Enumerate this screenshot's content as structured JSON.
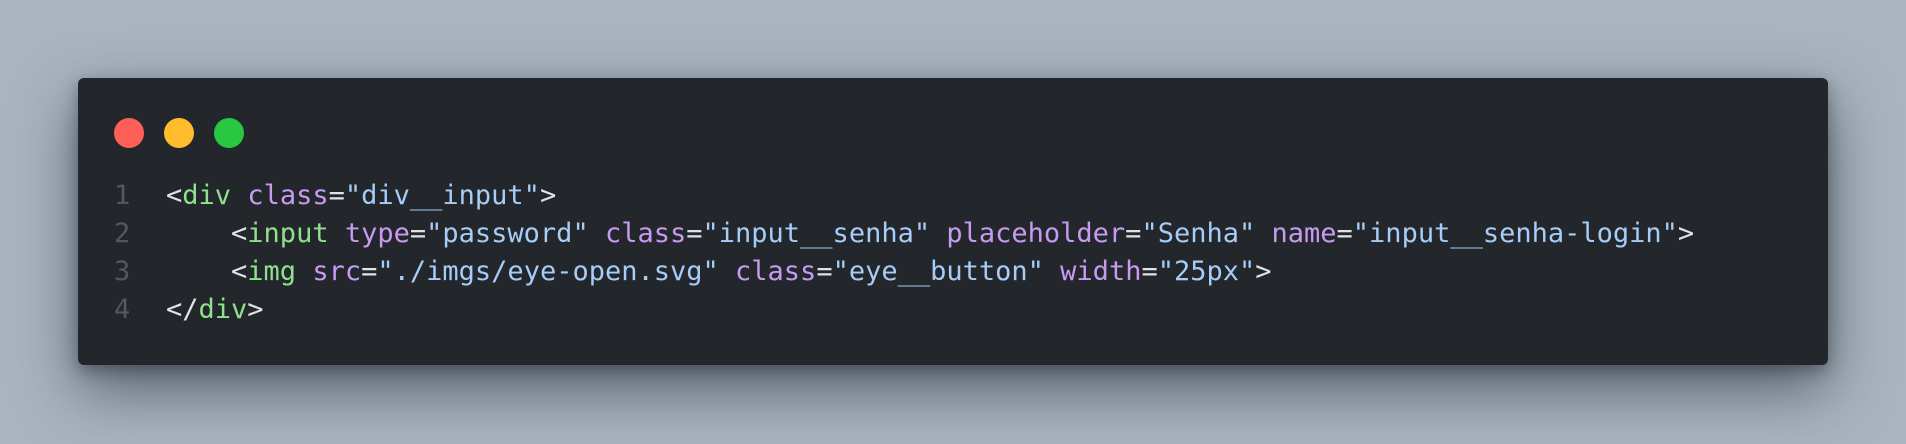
{
  "window": {
    "controls": [
      {
        "name": "close",
        "color": "#ff5f57"
      },
      {
        "name": "minimize",
        "color": "#ffbd2e"
      },
      {
        "name": "maximize",
        "color": "#28c840"
      }
    ]
  },
  "colors": {
    "background": "#a9b4bf",
    "editor": "#23272c",
    "line_number": "#505861",
    "tag": "#8fe28b",
    "attribute": "#c79bf0",
    "string": "#a6cdf7",
    "punctuation": "#dfe3e8"
  },
  "code": {
    "lines": [
      {
        "number": "1",
        "indent": "",
        "tokens": [
          {
            "t": "punct",
            "v": "<"
          },
          {
            "t": "tag",
            "v": "div"
          },
          {
            "t": "punct",
            "v": " "
          },
          {
            "t": "attr",
            "v": "class"
          },
          {
            "t": "punct",
            "v": "="
          },
          {
            "t": "str",
            "v": "\"div__input\""
          },
          {
            "t": "punct",
            "v": ">"
          }
        ]
      },
      {
        "number": "2",
        "indent": "    ",
        "tokens": [
          {
            "t": "punct",
            "v": "<"
          },
          {
            "t": "tag",
            "v": "input"
          },
          {
            "t": "punct",
            "v": " "
          },
          {
            "t": "attr",
            "v": "type"
          },
          {
            "t": "punct",
            "v": "="
          },
          {
            "t": "str",
            "v": "\"password\""
          },
          {
            "t": "punct",
            "v": " "
          },
          {
            "t": "attr",
            "v": "class"
          },
          {
            "t": "punct",
            "v": "="
          },
          {
            "t": "str",
            "v": "\"input__senha\""
          },
          {
            "t": "punct",
            "v": " "
          },
          {
            "t": "attr",
            "v": "placeholder"
          },
          {
            "t": "punct",
            "v": "="
          },
          {
            "t": "str",
            "v": "\"Senha\""
          },
          {
            "t": "punct",
            "v": " "
          },
          {
            "t": "attr",
            "v": "name"
          },
          {
            "t": "punct",
            "v": "="
          },
          {
            "t": "str",
            "v": "\"input__senha-login\""
          },
          {
            "t": "punct",
            "v": ">"
          }
        ]
      },
      {
        "number": "3",
        "indent": "    ",
        "tokens": [
          {
            "t": "punct",
            "v": "<"
          },
          {
            "t": "tag",
            "v": "img"
          },
          {
            "t": "punct",
            "v": " "
          },
          {
            "t": "attr",
            "v": "src"
          },
          {
            "t": "punct",
            "v": "="
          },
          {
            "t": "str",
            "v": "\"./imgs/eye-open.svg\""
          },
          {
            "t": "punct",
            "v": " "
          },
          {
            "t": "attr",
            "v": "class"
          },
          {
            "t": "punct",
            "v": "="
          },
          {
            "t": "str",
            "v": "\"eye__button\""
          },
          {
            "t": "punct",
            "v": " "
          },
          {
            "t": "attr",
            "v": "width"
          },
          {
            "t": "punct",
            "v": "="
          },
          {
            "t": "str",
            "v": "\"25px\""
          },
          {
            "t": "punct",
            "v": ">"
          }
        ]
      },
      {
        "number": "4",
        "indent": "",
        "tokens": [
          {
            "t": "punct",
            "v": "</"
          },
          {
            "t": "tag",
            "v": "div"
          },
          {
            "t": "punct",
            "v": ">"
          }
        ]
      }
    ]
  }
}
